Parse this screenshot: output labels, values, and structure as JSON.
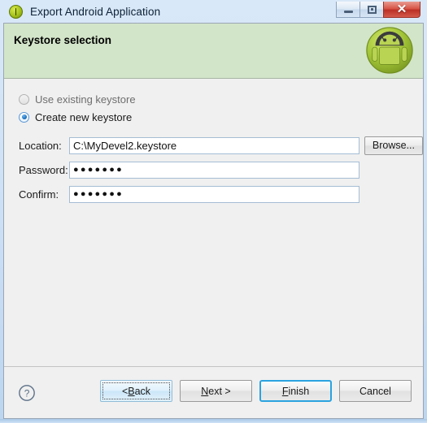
{
  "window": {
    "title": "Export Android Application",
    "icon": "android-export-icon",
    "controls": {
      "minimize": "minimize-icon",
      "maximize": "maximize-icon",
      "close": "✕"
    }
  },
  "header": {
    "title": "Keystore selection",
    "icon": "android-robot-icon",
    "background_color": "#d3e5c9"
  },
  "options": {
    "use_existing": {
      "label": "Use existing keystore",
      "selected": false
    },
    "create_new": {
      "label": "Create new keystore",
      "selected": true
    }
  },
  "form": {
    "location": {
      "label": "Location:",
      "value": "C:\\MyDevel2.keystore",
      "placeholder": ""
    },
    "password": {
      "label": "Password:",
      "value": "●●●●●●●",
      "placeholder": ""
    },
    "confirm": {
      "label": "Confirm:",
      "value": "●●●●●●●",
      "placeholder": ""
    },
    "browse_label": "Browse..."
  },
  "footer": {
    "help_icon": "question-mark-icon",
    "buttons": {
      "back": {
        "prefix": "< ",
        "accel": "B",
        "suffix": "ack"
      },
      "next": {
        "prefix": "",
        "accel": "N",
        "suffix": "ext >"
      },
      "finish": {
        "prefix": "",
        "accel": "F",
        "suffix": "inish"
      },
      "cancel": {
        "prefix": "",
        "accel": "",
        "suffix": "Cancel"
      }
    }
  },
  "colors": {
    "accent": "#2aa3e0",
    "header_green": "#d3e5c9",
    "titlebar_blue": "#cfe2f6",
    "close_red": "#bb3026"
  }
}
